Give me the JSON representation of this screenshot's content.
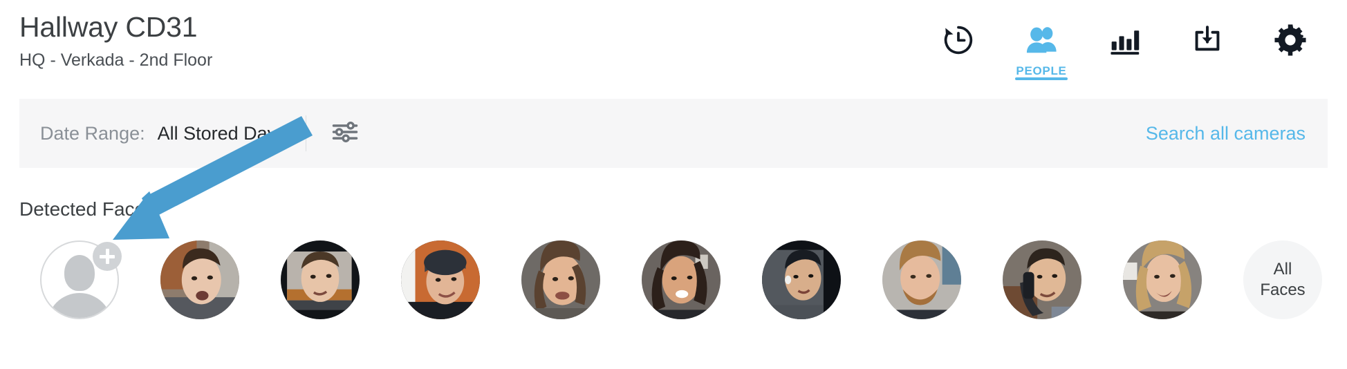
{
  "header": {
    "title": "Hallway CD31",
    "subtitle": "HQ - Verkada - 2nd Floor",
    "nav": [
      {
        "id": "history",
        "icon": "history-clock-icon",
        "label": "",
        "active": false
      },
      {
        "id": "people",
        "icon": "people-icon",
        "label": "PEOPLE",
        "active": true
      },
      {
        "id": "analytics",
        "icon": "bar-chart-icon",
        "label": "",
        "active": false
      },
      {
        "id": "download",
        "icon": "download-icon",
        "label": "",
        "active": false
      },
      {
        "id": "settings",
        "icon": "gear-icon",
        "label": "",
        "active": false
      }
    ]
  },
  "filter_bar": {
    "date_range_label": "Date Range:",
    "date_range_value": "All Stored Days",
    "tune_icon": "sliders-filter-icon",
    "search_all_cameras": "Search all cameras"
  },
  "faces_section": {
    "title": "Detected Faces",
    "add_face": {
      "icon": "add-person-icon",
      "badge_icon": "plus-icon"
    },
    "faces": [
      {
        "id": "face-1",
        "icon": "face-thumbnail",
        "skin": "#e8c6ad",
        "hair": "#3b2a1e",
        "bg": "#8e7c6d",
        "shirt": "#55585e"
      },
      {
        "id": "face-2",
        "icon": "face-thumbnail",
        "skin": "#e7c4a8",
        "hair": "#4b3827",
        "bg": "#b9b3ac",
        "shirt": "#3f4348"
      },
      {
        "id": "face-3",
        "icon": "face-thumbnail",
        "skin": "#e2b596",
        "hair": "#20242b",
        "bg": "#c86a32",
        "shirt": "#1b1e24"
      },
      {
        "id": "face-4",
        "icon": "face-thumbnail",
        "skin": "#e3b593",
        "hair": "#5a4230",
        "bg": "#6e6a66",
        "shirt": "#5d5954"
      },
      {
        "id": "face-5",
        "icon": "face-thumbnail",
        "skin": "#d9a37c",
        "hair": "#2c201a",
        "bg": "#6a6460",
        "shirt": "#26272b"
      },
      {
        "id": "face-6",
        "icon": "face-thumbnail",
        "skin": "#d8ae8b",
        "hair": "#181c22",
        "bg": "#53585e",
        "shirt": "#4c5157"
      },
      {
        "id": "face-7",
        "icon": "face-thumbnail",
        "skin": "#e6bb9d",
        "hair": "#a97a44",
        "bg": "#b8b5b0",
        "shirt": "#2c3038"
      },
      {
        "id": "face-8",
        "icon": "face-thumbnail",
        "skin": "#e0b896",
        "hair": "#2d241d",
        "bg": "#7b736b",
        "shirt": "#7e8896"
      },
      {
        "id": "face-9",
        "icon": "face-thumbnail",
        "skin": "#e8c0a2",
        "hair": "#c6a269",
        "bg": "#87837f",
        "shirt": "#2e2a27"
      }
    ],
    "all_faces_line1": "All",
    "all_faces_line2": "Faces"
  },
  "annotation": {
    "arrow_icon": "pointer-arrow-icon",
    "color": "#4a9dcf"
  },
  "colors": {
    "accent_blue": "#56b8e9",
    "icon_dark": "#131a24",
    "filter_bg": "#f6f6f7",
    "text_dark": "#3c4043",
    "text_muted": "#8a9097"
  }
}
